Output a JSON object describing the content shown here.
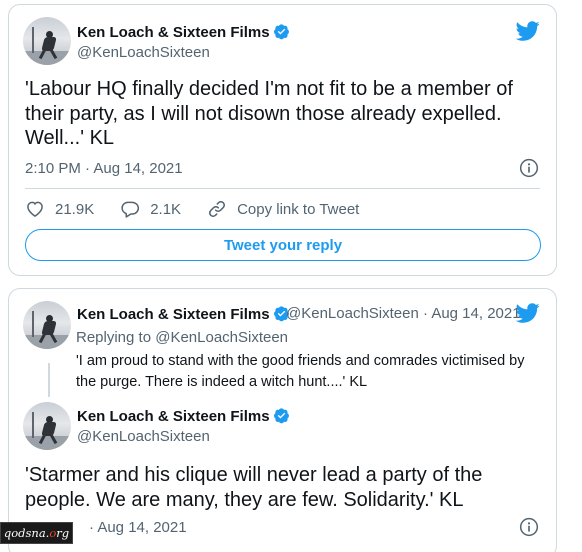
{
  "colors": {
    "accent": "#1d9bf0",
    "text_primary": "#0f1419",
    "text_secondary": "#536471",
    "border": "#cfd9de"
  },
  "tweet1": {
    "author_name": "Ken Loach & Sixteen Films",
    "handle": "@KenLoachSixteen",
    "text": "'Labour HQ finally decided I'm not fit to be a member of their party, as I will not disown those already expelled. Well...' KL",
    "timestamp": "2:10 PM · Aug 14, 2021",
    "likes": "21.9K",
    "replies": "2.1K",
    "copy_link_label": "Copy link to Tweet",
    "reply_button_label": "Tweet your reply",
    "icons": [
      "twitter-logo-icon",
      "verified-badge-icon",
      "info-icon",
      "heart-icon",
      "reply-bubble-icon",
      "link-icon"
    ]
  },
  "tweet2": {
    "parent": {
      "author_name": "Ken Loach & Sixteen Films",
      "handle_date": "@KenLoachSixteen · Aug 14, 2021",
      "replying_to": "Replying to @KenLoachSixteen",
      "text": "'I am proud to stand with the good friends and comrades victimised by the purge. There is indeed a witch hunt....' KL"
    },
    "main": {
      "author_name": "Ken Loach & Sixteen Films",
      "handle": "@KenLoachSixteen",
      "text": "'Starmer and his clique will never lead a party of the people. We are many, they are few. Solidarity.' KL",
      "timestamp_visible": "· Aug 14, 2021"
    }
  },
  "watermark": {
    "prefix": "qodsna.",
    "o_letter": "o",
    "suffix": "rg"
  }
}
